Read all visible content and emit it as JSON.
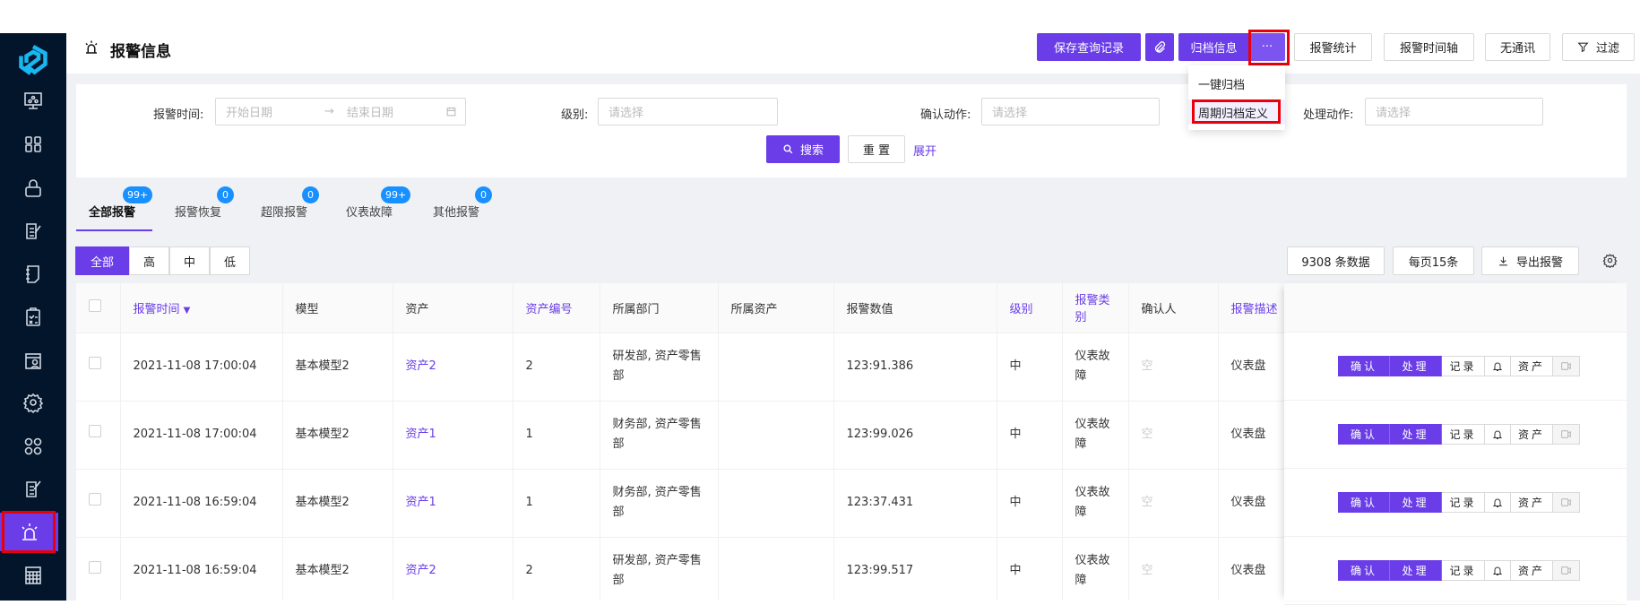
{
  "sidebar": {
    "items": [
      {
        "icon": "monitor-icon"
      },
      {
        "icon": "grid-icon"
      },
      {
        "icon": "lock-icon"
      },
      {
        "icon": "edit-icon"
      },
      {
        "icon": "notebook-icon"
      },
      {
        "icon": "clipboard-check-icon"
      },
      {
        "icon": "window-user-icon"
      },
      {
        "icon": "gear-icon"
      },
      {
        "icon": "apps-icon"
      },
      {
        "icon": "edit-note-icon"
      },
      {
        "icon": "alarm-icon",
        "active": true
      },
      {
        "icon": "calculator-icon"
      }
    ]
  },
  "header": {
    "title": "报警信息",
    "buttons": {
      "save_query": "保存查询记录",
      "archive_info": "归档信息",
      "more": "···",
      "stats": "报警统计",
      "timeline": "报警时间轴",
      "no_comm": "无通讯",
      "filter": "过滤"
    }
  },
  "dropdown": {
    "items": [
      "一键归档",
      "周期归档定义"
    ]
  },
  "filters": {
    "alarm_time_label": "报警时间:",
    "start_placeholder": "开始日期",
    "end_placeholder": "结束日期",
    "level_label": "级别:",
    "level_placeholder": "请选择",
    "confirm_label": "确认动作:",
    "confirm_placeholder": "请选择",
    "handle_label": "处理动作:",
    "handle_placeholder": "请选择",
    "search": "搜索",
    "reset": "重 置",
    "expand": "展开"
  },
  "tabs": [
    {
      "label": "全部报警",
      "badge": "99+",
      "active": true
    },
    {
      "label": "报警恢复",
      "badge": "0"
    },
    {
      "label": "超限报警",
      "badge": "0"
    },
    {
      "label": "仪表故障",
      "badge": "99+"
    },
    {
      "label": "其他报警",
      "badge": "0"
    }
  ],
  "levels": [
    "全部",
    "高",
    "中",
    "低"
  ],
  "table_toolbar": {
    "count": "9308 条数据",
    "page_size": "每页15条",
    "export": "导出报警"
  },
  "table": {
    "columns": [
      "报警时间",
      "模型",
      "资产",
      "资产编号",
      "所属部门",
      "所属资产",
      "报警数值",
      "级别",
      "报警类别",
      "确认人",
      "报警描述"
    ],
    "rows": [
      [
        "2021-11-08 17:00:04",
        "基本模型2",
        "资产2",
        "2",
        "研发部, 资产零售部",
        "",
        "123:91.386",
        "中",
        "仪表故障",
        "空",
        "仪表盘"
      ],
      [
        "2021-11-08 17:00:04",
        "基本模型2",
        "资产1",
        "1",
        "财务部, 资产零售部",
        "",
        "123:99.026",
        "中",
        "仪表故障",
        "空",
        "仪表盘"
      ],
      [
        "2021-11-08 16:59:04",
        "基本模型2",
        "资产1",
        "1",
        "财务部, 资产零售部",
        "",
        "123:37.431",
        "中",
        "仪表故障",
        "空",
        "仪表盘"
      ],
      [
        "2021-11-08 16:59:04",
        "基本模型2",
        "资产2",
        "2",
        "研发部, 资产零售部",
        "",
        "123:99.517",
        "中",
        "仪表故障",
        "空",
        "仪表盘"
      ]
    ],
    "actions": {
      "confirm": "确认",
      "handle": "处理",
      "record": "记录",
      "asset": "资产"
    }
  },
  "colors": {
    "primary": "#6a3de8",
    "sidebar": "#03152b",
    "badge": "#1890ff",
    "highlight": "#e8000b"
  }
}
